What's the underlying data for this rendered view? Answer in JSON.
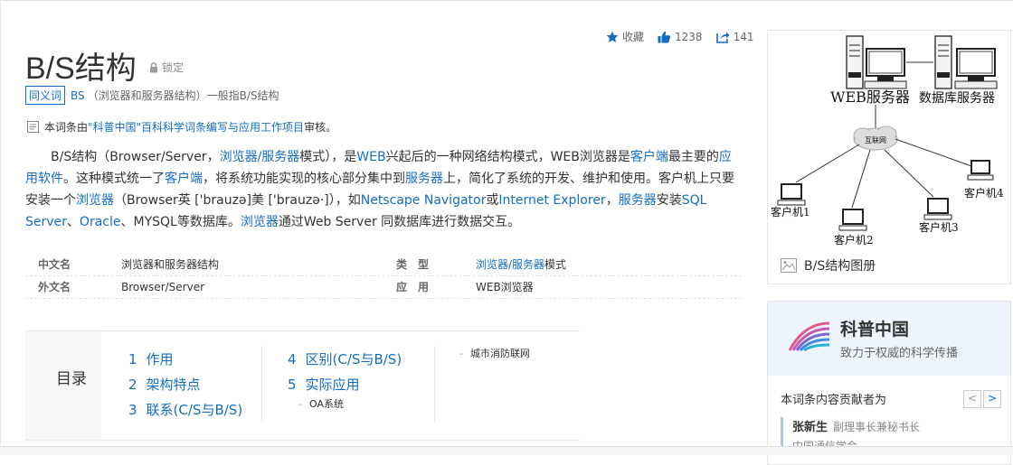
{
  "actions": {
    "favorite_label": "收藏",
    "like_count": "1238",
    "share_count": "141"
  },
  "title": "B/S结构",
  "lock_label": "锁定",
  "synonym": {
    "badge": "同义词",
    "term": "BS",
    "text": "（浏览器和服务器结构）一般指B/S结构"
  },
  "review": {
    "prefix": "本词条由",
    "link": "\"科普中国\"百科科学词条编写与应用工作项目",
    "suffix": " 审核。"
  },
  "intro": {
    "t1": "B/S结构（Browser/Server，",
    "l1": "浏览器/服务器",
    "t2": "模式），是",
    "l2": "WEB",
    "t3": "兴起后的一种网络结构模式，WEB浏览器是",
    "l3": "客户端",
    "t4": "最主要的",
    "l4": "应用软件",
    "t5": "。这种模式统一了",
    "l5": "客户端",
    "t6": "，将系统功能实现的核心部分集中到",
    "l6": "服务器",
    "t7": "上，简化了系统的开发、维护和使用。客户机上只要安装一个",
    "l7": "浏览器",
    "t8": "（Browser英 ['brauzə]美 ['brauzə·]），如",
    "l8": "Netscape Navigator",
    "t9": "或",
    "l9": "Internet Explorer",
    "t10": "，",
    "l10": "服务器",
    "t11": "安装",
    "l11": "SQL Server",
    "t12": "、",
    "l12": "Oracle",
    "t13": "、MYSQL等数据库。",
    "l13": "浏览器",
    "t14": "通过Web Server 同数据库进行数据交互。"
  },
  "basic_info": {
    "r1_k1": "中文名",
    "r1_v1": "浏览器和服务器结构",
    "r1_k2": "类型",
    "r1_v2_link": "浏览器/服务器",
    "r1_v2_text": "模式",
    "r2_k1": "外文名",
    "r2_v1": "Browser/Server",
    "r2_k2": "应用",
    "r2_v2": "WEB浏览器"
  },
  "catalog": {
    "title": "目录",
    "items": [
      {
        "num": "1",
        "label": "作用"
      },
      {
        "num": "2",
        "label": "架构特点"
      },
      {
        "num": "3",
        "label": "联系(C/S与B/S)"
      },
      {
        "num": "4",
        "label": "区别(C/S与B/S)"
      },
      {
        "num": "5",
        "label": "实际应用"
      }
    ],
    "sub_oa": "OA系统",
    "sub_fire": "城市消防联网"
  },
  "diagram": {
    "web_server": "WEB服务器",
    "db_server": "数据库服务器",
    "internet": "互联网",
    "client1": "客户机1",
    "client2": "客户机2",
    "client3": "客户机3",
    "client4": "客户机4",
    "caption": "B/S结构图册"
  },
  "kepu": {
    "name": "科普中国",
    "slogan": "致力于权威的科学传播",
    "contributors_label": "本词条内容贡献者为",
    "prev": "<",
    "next": ">",
    "person_name": "张新生",
    "person_role": "副理事长兼秘书长",
    "person_org": "中国通信学会"
  },
  "colors": {
    "link": "#136ec2",
    "text": "#333333",
    "kepu_bg": "#eef4fb"
  }
}
